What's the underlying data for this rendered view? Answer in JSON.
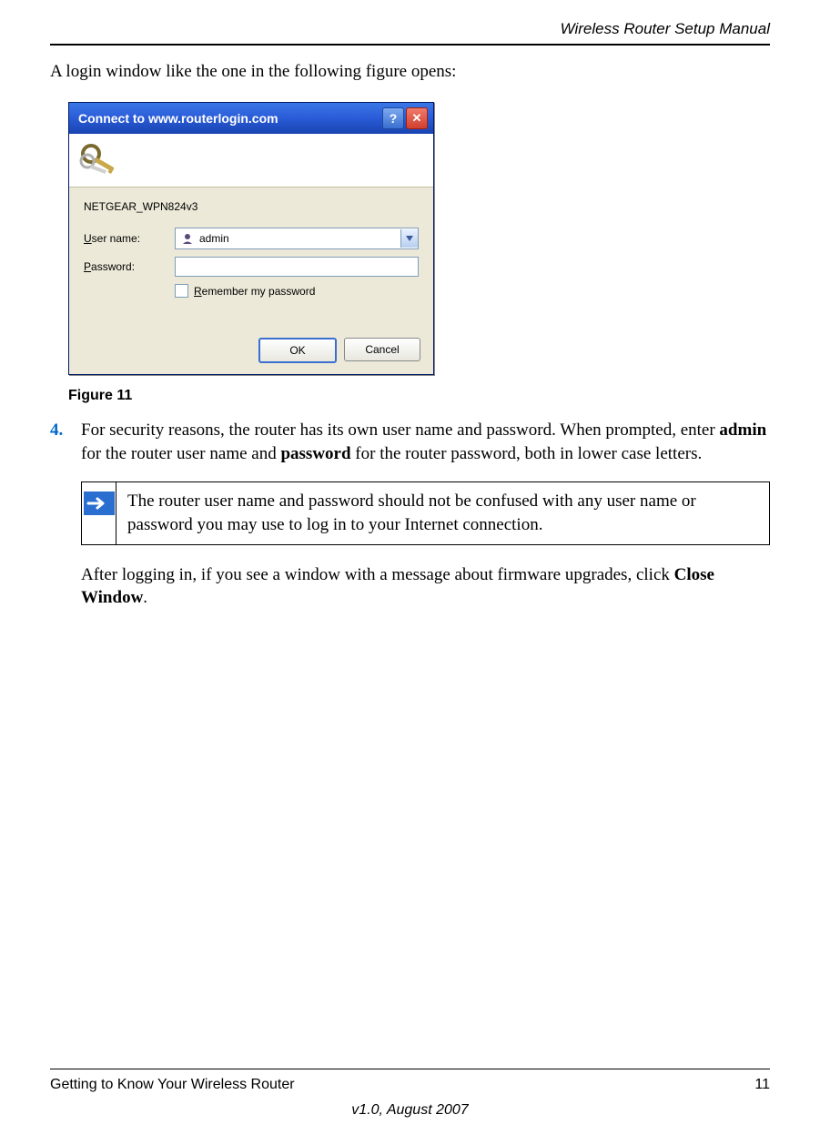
{
  "header": {
    "title": "Wireless Router Setup Manual"
  },
  "intro": "A login window like the one in the following figure opens:",
  "dialog": {
    "title": "Connect to www.routerlogin.com",
    "realm": "NETGEAR_WPN824v3",
    "username_label_pre": "U",
    "username_label_post": "ser name:",
    "username_value": "admin",
    "password_label_pre": "P",
    "password_label_post": "assword:",
    "remember_pre": "R",
    "remember_post": "emember my password",
    "ok": "OK",
    "cancel": "Cancel"
  },
  "figure_caption": "Figure 11",
  "step4": {
    "num": "4.",
    "text_a": "For security reasons, the router has its own user name and password. When prompted, enter ",
    "bold1": "admin",
    "text_b": " for the router user name and ",
    "bold2": "password",
    "text_c": " for the router password, both in lower case letters."
  },
  "note": "The router user name and password should not be confused with any user name or password you may use to log in to your Internet connection.",
  "after": {
    "text_a": "After logging in, if you see a window with a message about firmware upgrades, click ",
    "bold": "Close Window",
    "text_b": "."
  },
  "footer": {
    "section": "Getting to Know Your Wireless Router",
    "page": "11",
    "version": "v1.0, August 2007"
  }
}
